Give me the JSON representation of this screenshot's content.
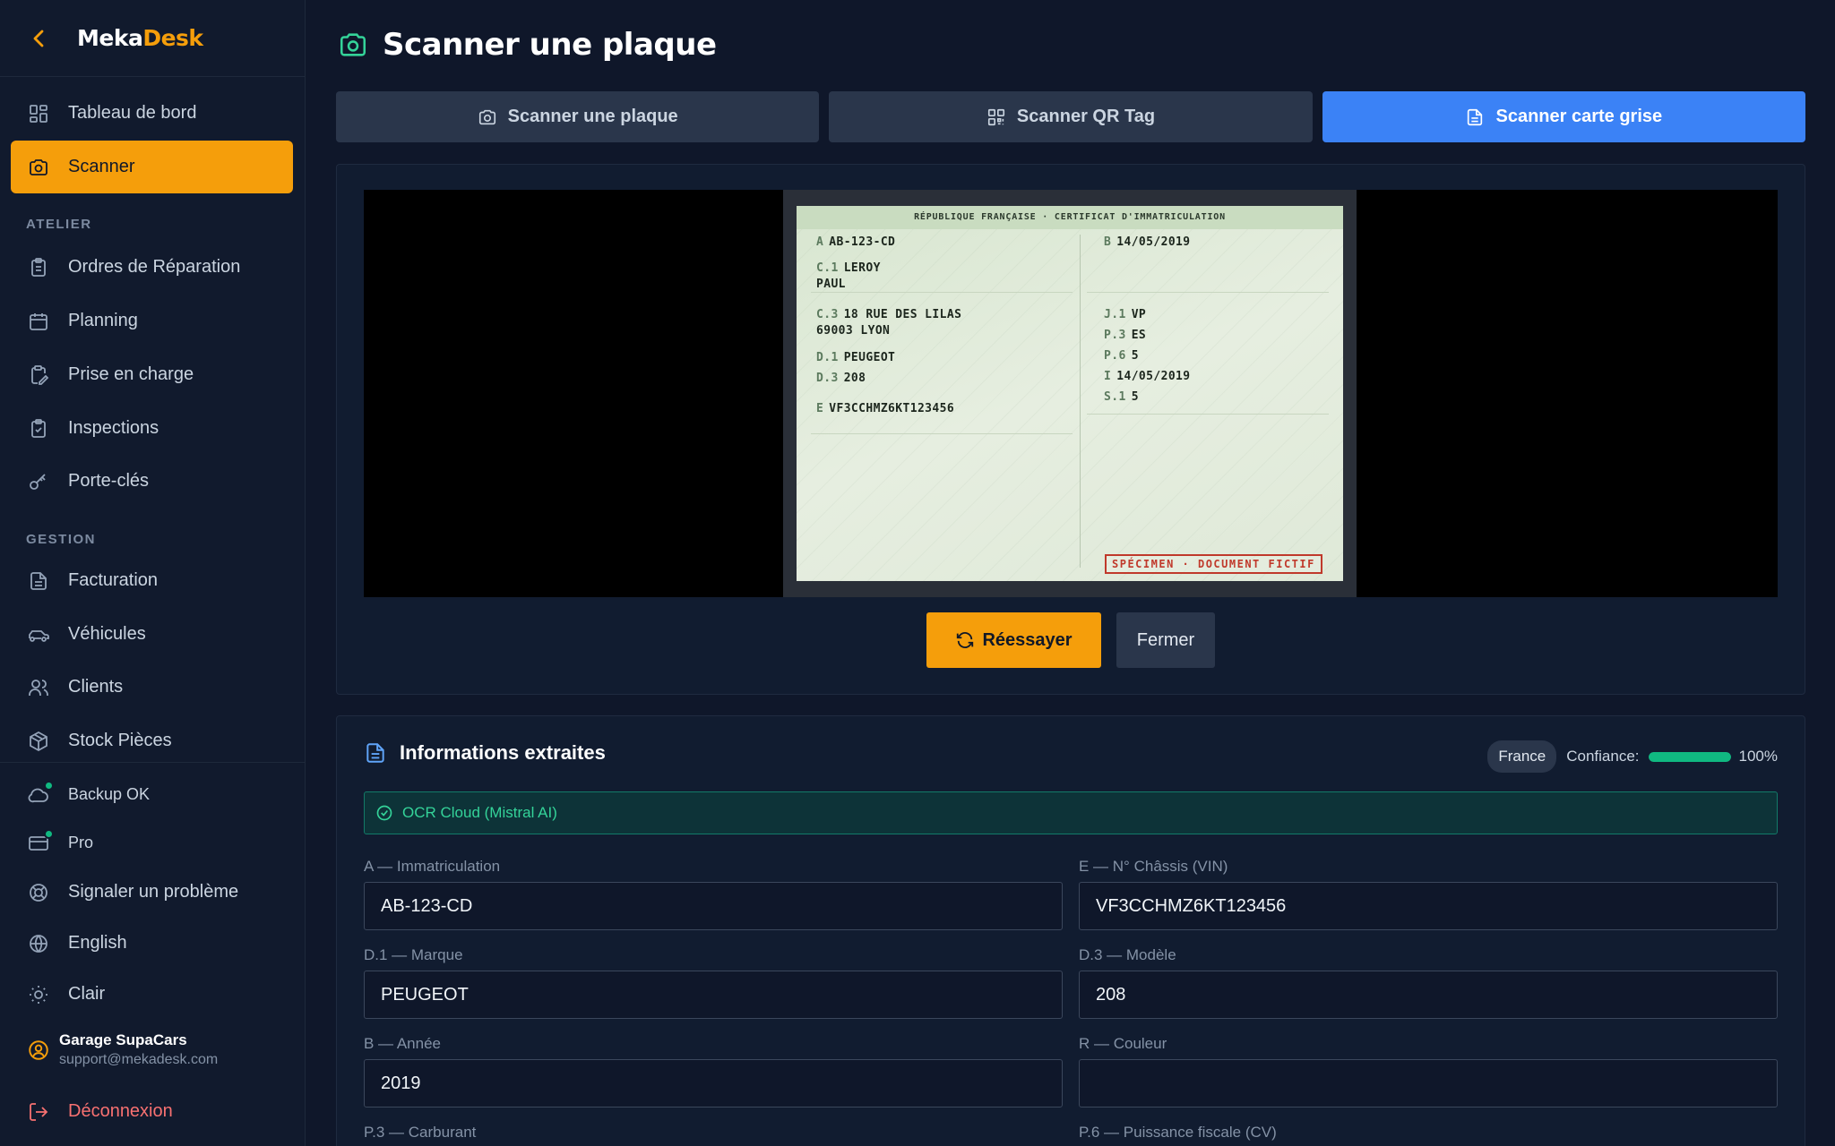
{
  "brand": {
    "name_part1": "Meka",
    "name_part2": "Desk"
  },
  "sidebar": {
    "items": [
      {
        "label": "Tableau de bord",
        "icon": "dashboard-icon"
      },
      {
        "label": "Scanner",
        "icon": "camera-icon",
        "active": true
      }
    ],
    "section_atelier": "ATELIER",
    "atelier_items": [
      {
        "label": "Ordres de Réparation",
        "icon": "clipboard-icon"
      },
      {
        "label": "Planning",
        "icon": "calendar-icon"
      },
      {
        "label": "Prise en charge",
        "icon": "clipboard-pen-icon"
      },
      {
        "label": "Inspections",
        "icon": "clipboard-check-icon"
      },
      {
        "label": "Porte-clés",
        "icon": "key-icon"
      }
    ],
    "section_gestion": "GESTION",
    "gestion_items": [
      {
        "label": "Facturation",
        "icon": "file-text-icon"
      },
      {
        "label": "Véhicules",
        "icon": "car-icon"
      },
      {
        "label": "Clients",
        "icon": "users-icon"
      },
      {
        "label": "Stock Pièces",
        "icon": "package-icon"
      }
    ],
    "bottom_items": [
      {
        "label": "Backup OK",
        "icon": "cloud-icon"
      },
      {
        "label": "Pro",
        "icon": "credit-card-icon"
      },
      {
        "label": "Signaler un problème",
        "icon": "lifebuoy-icon"
      },
      {
        "label": "English",
        "icon": "globe-icon"
      },
      {
        "label": "Clair",
        "icon": "sun-icon"
      }
    ],
    "user": {
      "name": "Garage SupaCars",
      "email": "support@mekadesk.com"
    },
    "logout": "Déconnexion"
  },
  "header": {
    "title": "Scanner une plaque"
  },
  "tabs": [
    {
      "label": "Scanner une plaque",
      "icon": "camera-icon"
    },
    {
      "label": "Scanner QR Tag",
      "icon": "qr-code-icon"
    },
    {
      "label": "Scanner carte grise",
      "icon": "file-text-icon",
      "active": true
    }
  ],
  "document": {
    "header": "RÉPUBLIQUE FRANÇAISE · CERTIFICAT D'IMMATRICULATION",
    "a_key": "A",
    "a_val": "AB-123-CD",
    "b_key": "B",
    "b_val": "14/05/2019",
    "c1_key": "C.1",
    "c1_val1": "LEROY",
    "c1_val2": "PAUL",
    "c3_key": "C.3",
    "c3_val1": "18 RUE DES LILAS",
    "c3_val2": "69003 LYON",
    "d1_key": "D.1",
    "d1_val": "PEUGEOT",
    "d3_key": "D.3",
    "d3_val": "208",
    "e_key": "E",
    "e_val": "VF3CCHMZ6KT123456",
    "j1_key": "J.1",
    "j1_val": "VP",
    "p3_key": "P.3",
    "p3_val": "ES",
    "p6_key": "P.6",
    "p6_val": "5",
    "i_key": "I",
    "i_val": "14/05/2019",
    "s1_key": "S.1",
    "s1_val": "5",
    "stamp": "SPÉCIMEN · DOCUMENT FICTIF"
  },
  "actions": {
    "retry": "Réessayer",
    "close": "Fermer"
  },
  "extracted": {
    "title": "Informations extraites",
    "country": "France",
    "confidence_label": "Confiance:",
    "confidence_value": "100%",
    "confidence_fraction": 1.0,
    "ocr_label": "OCR Cloud (Mistral AI)",
    "fields": {
      "a_label": "A — Immatriculation",
      "a_value": "AB-123-CD",
      "e_label": "E — N° Châssis (VIN)",
      "e_value": "VF3CCHMZ6KT123456",
      "d1_label": "D.1 — Marque",
      "d1_value": "PEUGEOT",
      "d3_label": "D.3 — Modèle",
      "d3_value": "208",
      "b_label": "B — Année",
      "b_value": "2019",
      "r_label": "R — Couleur",
      "r_value": "",
      "p3_label": "P.3 — Carburant",
      "p6_label": "P.6 — Puissance fiscale (CV)"
    }
  },
  "colors": {
    "accent": "#f59e0b",
    "primary": "#3b82f6",
    "success": "#10b981",
    "danger": "#f87171"
  }
}
